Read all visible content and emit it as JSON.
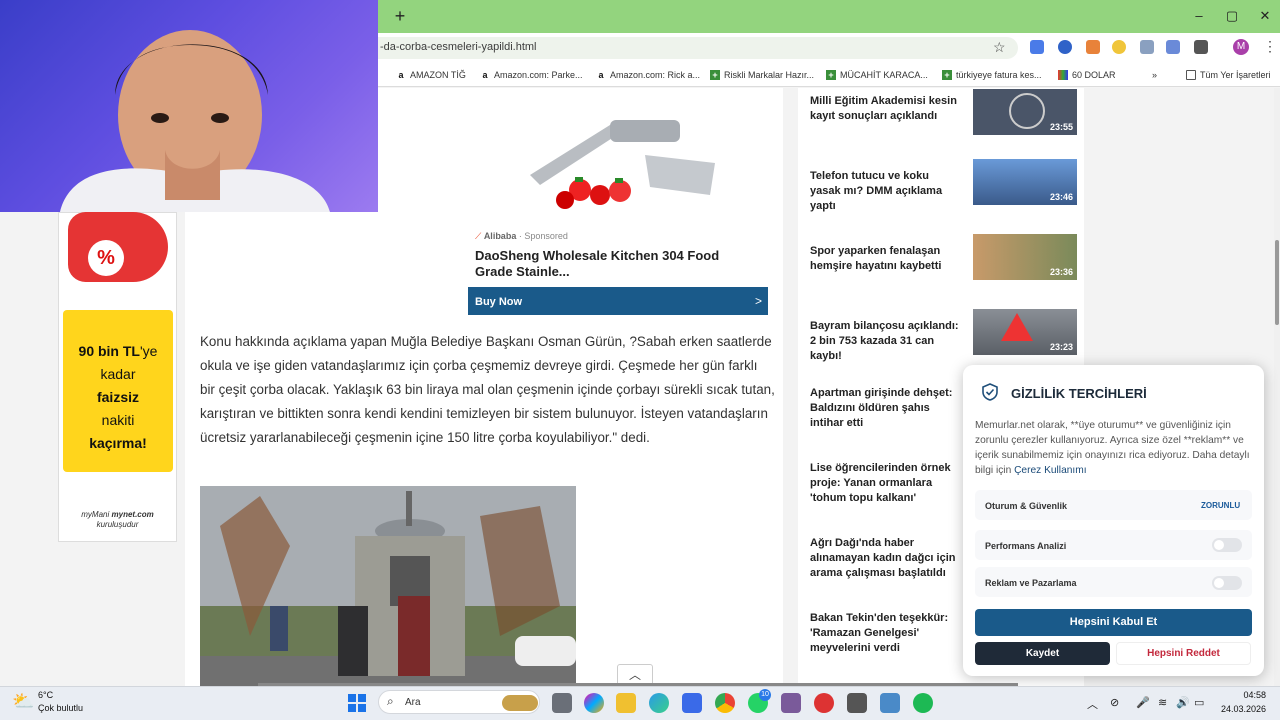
{
  "browser": {
    "url": "-da-corba-cesmeleri-yapildi.html",
    "bookmarks": [
      {
        "label": "AMAZON TİĞ",
        "icon": "amazon-icon"
      },
      {
        "label": "Amazon.com: Parke...",
        "icon": "amazon-icon"
      },
      {
        "label": "Amazon.com: Rick a...",
        "icon": "amazon-icon"
      },
      {
        "label": "Riskli Markalar Hazır...",
        "icon": "green-cross-icon"
      },
      {
        "label": "MÜCAHİT KARACA...",
        "icon": "green-cross-icon"
      },
      {
        "label": "türkiyeye fatura kes...",
        "icon": "green-cross-icon"
      },
      {
        "label": "60 DOLAR",
        "icon": "colorful-icon"
      }
    ],
    "all_bookmarks_label": "Tüm Yer İşaretleri",
    "avatar_letter": "M"
  },
  "left_ad": {
    "percent": "%",
    "line1": "90 bin TL",
    "line1_suffix": "'ye",
    "line2": "kadar",
    "line3": "faizsiz",
    "line4": "nakiti",
    "line5": "kaçırma!",
    "footer1": "myMani",
    "footer1b": "mynet.com",
    "footer2": "kuruluşudur"
  },
  "ad": {
    "source": "Alibaba",
    "sponsored": "· Sponsored",
    "title": "DaoSheng Wholesale Kitchen 304 Food Grade Stainle...",
    "cta": "Buy Now",
    "cta_arrow": ">"
  },
  "article": {
    "body": "Konu hakkında açıklama yapan Muğla Belediye Başkanı Osman Gürün, ?Sabah erken saatlerde okula ve işe giden vatandaşlarımız için çorba çeşmemiz devreye girdi. Çeşmede her gün farklı bir çeşit çorba olacak. Yaklaşık 63 bin liraya mal olan çeşmenin içinde çorbayı sürekli sıcak tutan, karıştıran ve bittikten sonra kendi kendini temizleyen bir sistem bulunuyor. İsteyen vatandaşların ücretsiz yararlanabileceği çeşmenin içine 150 litre çorba koyulabiliyor.\" dedi."
  },
  "news": [
    {
      "title": "Milli Eğitim Akademisi kesin kayıt sonuçları açıklandı",
      "time": "23:55"
    },
    {
      "title": "Telefon tutucu ve koku yasak mı? DMM açıklama yaptı",
      "time": "23:46"
    },
    {
      "title": "Spor yaparken fenalaşan hemşire hayatını kaybetti",
      "time": "23:36"
    },
    {
      "title": "Bayram bilançosu açıklandı: 2 bin 753 kazada 31 can kaybı!",
      "time": "23:23"
    },
    {
      "title": "Apartman girişinde dehşet: Baldızını öldüren şahıs intihar etti",
      "time": ""
    },
    {
      "title": "Lise öğrencilerinden örnek proje: Yanan ormanlara 'tohum topu kalkanı'",
      "time": ""
    },
    {
      "title": "Ağrı Dağı'nda haber alınamayan kadın dağcı için arama çalışması başlatıldı",
      "time": ""
    },
    {
      "title": "Bakan Tekin'den teşekkür: 'Ramazan Genelgesi' meyvelerini verdi",
      "time": ""
    }
  ],
  "cookie": {
    "title": "GİZLİLİK TERCİHLERİ",
    "text": "Memurlar.net olarak, **üye oturumu** ve güvenliğiniz için zorunlu çerezler kullanıyoruz. Ayrıca size özel **reklam** ve içerik sunabilmemiz için onayınızı rica ediyoruz. Daha detaylı bilgi için ",
    "link": "Çerez Kullanımı",
    "rows": [
      {
        "label": "Oturum & Güvenlik",
        "badge": "ZORUNLU"
      },
      {
        "label": "Performans Analizi"
      },
      {
        "label": "Reklam ve Pazarlama"
      }
    ],
    "accept_all": "Hepsini Kabul Et",
    "save": "Kaydet",
    "reject_all": "Hepsini Reddet"
  },
  "taskbar": {
    "temp": "6°C",
    "condition": "Çok bulutlu",
    "search_placeholder": "Ara",
    "time": "04:58",
    "date": "24.03.2026",
    "badge": "10"
  }
}
